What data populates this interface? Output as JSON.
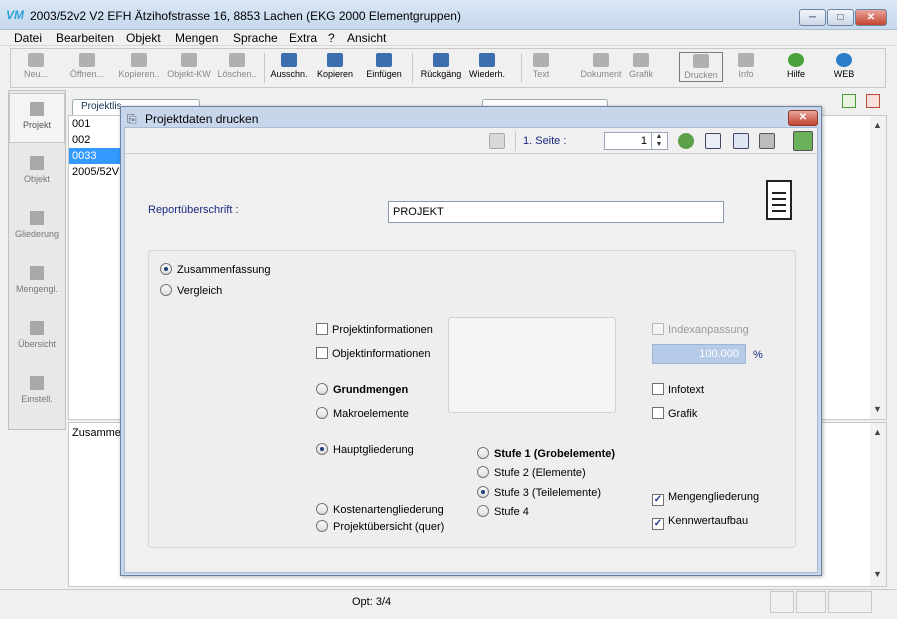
{
  "window": {
    "logo_text": "VM",
    "title": "2003/52v2 V2 EFH Ätzihofstrasse 16, 8853 Lachen (EKG 2000 Elementgruppen)",
    "minimize": "─",
    "maximize": "□",
    "close": "✕"
  },
  "menu": [
    "Datei",
    "Bearbeiten",
    "Objekt",
    "Mengen",
    "Sprache",
    "Extra",
    "?",
    "Ansicht"
  ],
  "toolbar": [
    {
      "label": "Neu...",
      "enabled": false
    },
    {
      "label": "Öffnen...",
      "enabled": false
    },
    {
      "label": "Kopieren..",
      "enabled": false
    },
    {
      "label": "Objekt-KW",
      "enabled": false
    },
    {
      "label": "Löschen..",
      "enabled": false
    },
    {
      "label": "Ausschn.",
      "enabled": true
    },
    {
      "label": "Kopieren",
      "enabled": true
    },
    {
      "label": "Einfügen",
      "enabled": true
    },
    {
      "label": "Rückgäng",
      "enabled": true
    },
    {
      "label": "Wiederh.",
      "enabled": true
    },
    {
      "label": "Text",
      "enabled": false
    },
    {
      "label": "Dokument",
      "enabled": false
    },
    {
      "label": "Grafik",
      "enabled": false
    },
    {
      "label": "Drucken",
      "enabled": false
    },
    {
      "label": "Info",
      "enabled": false
    },
    {
      "label": "Hilfe",
      "enabled": true
    },
    {
      "label": "WEB",
      "enabled": true
    }
  ],
  "nav": [
    "Projekt",
    "Objekt",
    "Gliederung",
    "Mengengl.",
    "Übersicht",
    "Einstell."
  ],
  "tabs": {
    "list_tab": "Projektlis"
  },
  "list": [
    "001",
    "002",
    "0033",
    "2005/52V"
  ],
  "bottom_label": "Zusamme",
  "status": {
    "text": "Opt: 3/4"
  },
  "dialog": {
    "title": "Projektdaten drucken",
    "close": "✕",
    "page_label": "1. Seite :",
    "page_value": "1",
    "report_label": "Reportüberschrift :",
    "report_value": "PROJEKT",
    "mode": {
      "zusammenfassung": "Zusammenfassung",
      "vergleich": "Vergleich"
    },
    "checks": {
      "projektinfo": "Projektinformationen",
      "objektinfo": "Objektinformationen",
      "indexanpassung": "Indexanpassung",
      "infotext": "Infotext",
      "grafik": "Grafik",
      "mengengliederung": "Mengengliederung",
      "kennwertaufbau": "Kennwertaufbau"
    },
    "index_value": "100.000",
    "index_unit": "%",
    "report_type": {
      "grundmengen": "Grundmengen",
      "makroelemente": "Makroelemente",
      "hauptgliederung": "Hauptgliederung",
      "kostenarten": "Kostenartengliederung",
      "projektuebersicht": "Projektübersicht (quer)"
    },
    "stufen": [
      "Stufe 1 (Grobelemente)",
      "Stufe 2 (Elemente)",
      "Stufe 3 (Teilelemente)",
      "Stufe 4"
    ],
    "check_mark": "✓",
    "spin_up": "▲",
    "spin_down": "▼"
  },
  "scroll": {
    "up": "▲",
    "down": "▼"
  }
}
